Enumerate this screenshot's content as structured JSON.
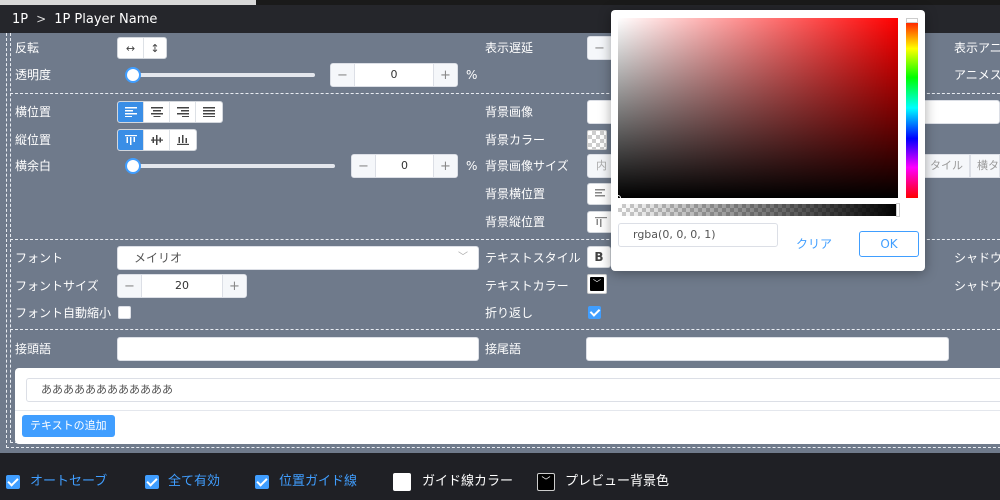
{
  "breadcrumb": {
    "root": "1P",
    "current": "1P Player Name"
  },
  "row1": {
    "flip_label": "反転",
    "flip_h": "↔",
    "flip_v": "↕",
    "delay_label": "表示遅延",
    "delay_minus": "−",
    "anim_label": "表示アニ"
  },
  "row2": {
    "opacity_label": "透明度",
    "opacity_value": "0",
    "unit": "%",
    "anime_label": "アニメス"
  },
  "row3": {
    "halign_label": "横位置",
    "bg_image_label": "背景画像"
  },
  "row4": {
    "valign_label": "縦位置",
    "bg_color_label": "背景カラー"
  },
  "row5": {
    "hpad_label": "横余白",
    "hpad_value": "0",
    "unit": "%",
    "bg_size_label": "背景画像サイズ",
    "bg_size_inner": "内",
    "tile_label": "タイル",
    "tile_label2": "横タ"
  },
  "row6": {
    "bg_hpos_label": "背景横位置"
  },
  "row7": {
    "bg_vpos_label": "背景縦位置"
  },
  "font": {
    "font_label": "フォント",
    "font_value": "メイリオ",
    "text_style_label": "テキストスタイル",
    "bold": "B",
    "shadow_label": "シャドウ"
  },
  "fontsize": {
    "label": "フォントサイズ",
    "value": "20",
    "text_color_label": "テキストカラー",
    "shadow_label2": "シャドウ"
  },
  "autoshrink": {
    "label": "フォント自動縮小",
    "wrap_label": "折り返し"
  },
  "affix": {
    "prefix_label": "接頭語",
    "suffix_label": "接尾語"
  },
  "text_entry": {
    "value": "ああああああああああああ",
    "add_button": "テキストの追加"
  },
  "footer": {
    "autosave": "オートセーブ",
    "enable_all": "全て有効",
    "guide_lines": "位置ガイド線",
    "guide_color": "ガイド線カラー",
    "preview_bg": "プレビュー背景色"
  },
  "color_picker": {
    "value": "rgba(0, 0, 0, 1)",
    "clear": "クリア",
    "ok": "OK"
  },
  "colors": {
    "accent": "#409eff",
    "panel": "#6f7a8b",
    "dark": "#1f2025"
  }
}
